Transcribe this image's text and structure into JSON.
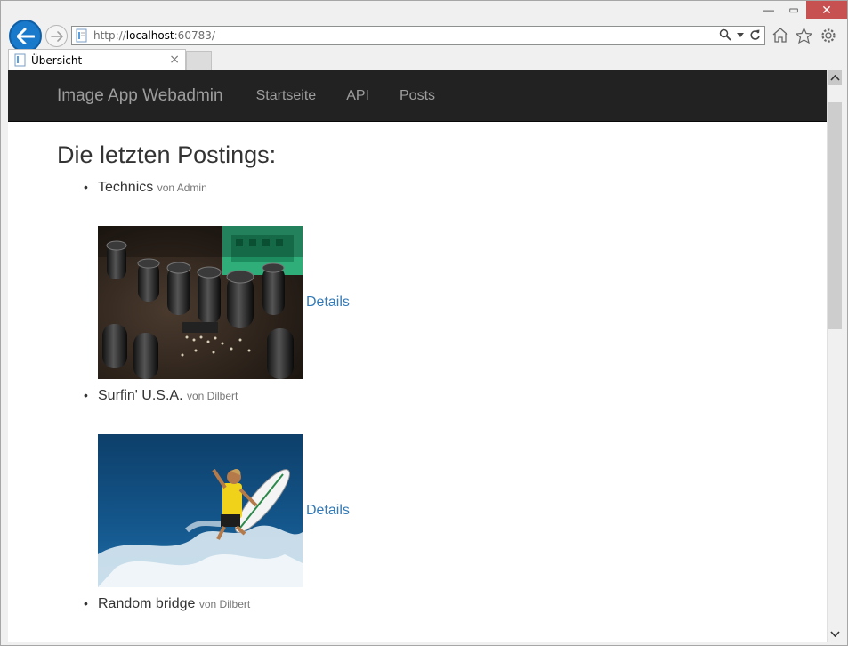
{
  "browser": {
    "url_prefix": "http://",
    "url_host": "localhost",
    "url_rest": ":60783/",
    "tab_title": "Übersicht",
    "close_glyph": "×",
    "minimize_glyph": "—",
    "maximize_glyph": "▭",
    "window_close_glyph": "✕"
  },
  "site": {
    "brand": "Image App Webadmin",
    "nav": [
      {
        "label": "Startseite"
      },
      {
        "label": "API"
      },
      {
        "label": "Posts"
      }
    ]
  },
  "main": {
    "heading": "Die letzten Postings:",
    "posts": [
      {
        "title": "Technics",
        "author": "von Admin",
        "details": "Details",
        "image": "circuit-board-photo"
      },
      {
        "title": "Surfin' U.S.A.",
        "author": "von Dilbert",
        "details": "Details",
        "image": "surfer-photo"
      },
      {
        "title": "Random bridge",
        "author": "von Dilbert"
      }
    ]
  },
  "colors": {
    "navbar_bg": "#222222",
    "navbar_text": "#9d9d9d",
    "link": "#337ab7",
    "ie_accent": "#1979ca",
    "window_close": "#c75050"
  }
}
